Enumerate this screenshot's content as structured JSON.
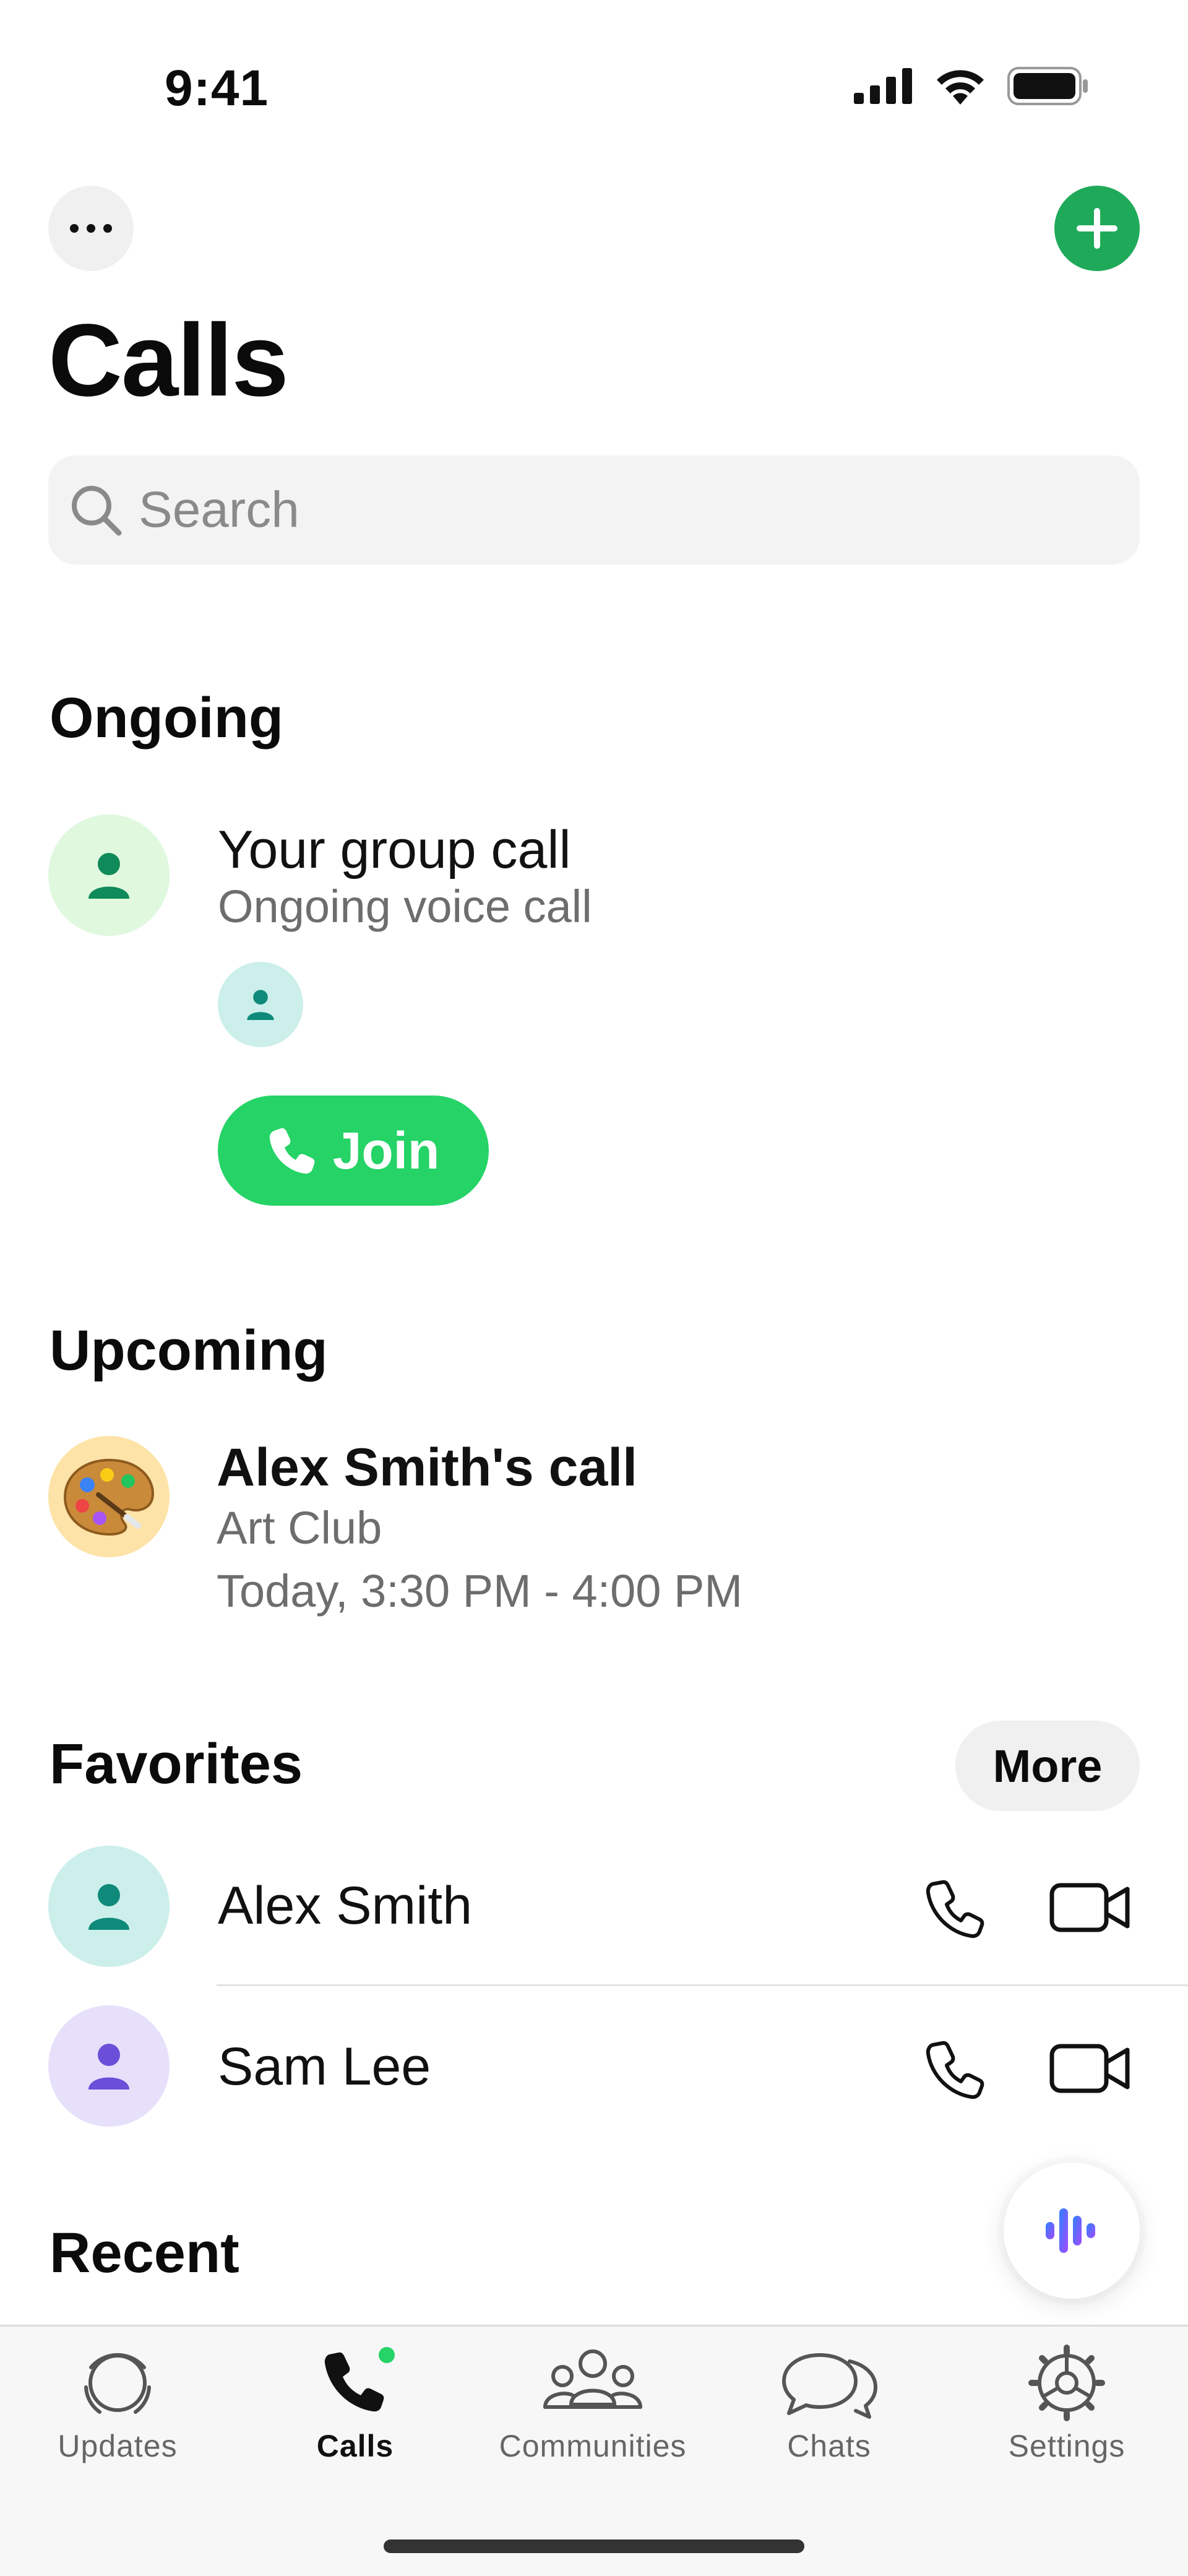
{
  "status_bar": {
    "time": "9:41"
  },
  "header": {
    "title": "Calls"
  },
  "search": {
    "placeholder": "Search"
  },
  "ongoing": {
    "section_title": "Ongoing",
    "call_title": "Your group call",
    "call_subtitle": "Ongoing voice call",
    "join_label": "Join"
  },
  "upcoming": {
    "section_title": "Upcoming",
    "event_title": "Alex Smith's call",
    "event_group": "Art Club",
    "event_time": "Today, 3:30 PM - 4:00 PM"
  },
  "favorites": {
    "section_title": "Favorites",
    "more_label": "More",
    "items": [
      {
        "name": "Alex Smith",
        "avatar_color": "#ccefeb",
        "icon_color": "#0f8a7a"
      },
      {
        "name": "Sam Lee",
        "avatar_color": "#e6e0fb",
        "icon_color": "#6b4fd8"
      }
    ]
  },
  "recent": {
    "section_title": "Recent"
  },
  "tabs": [
    {
      "label": "Updates",
      "icon": "updates-icon",
      "active": false
    },
    {
      "label": "Calls",
      "icon": "phone-icon",
      "active": true
    },
    {
      "label": "Communities",
      "icon": "communities-icon",
      "active": false
    },
    {
      "label": "Chats",
      "icon": "chats-icon",
      "active": false
    },
    {
      "label": "Settings",
      "icon": "settings-icon",
      "active": false
    }
  ],
  "colors": {
    "accent_green": "#25d366",
    "add_button": "#1faa59",
    "ongoing_avatar": "#dff8de",
    "upcoming_avatar": "#fde3a7"
  }
}
